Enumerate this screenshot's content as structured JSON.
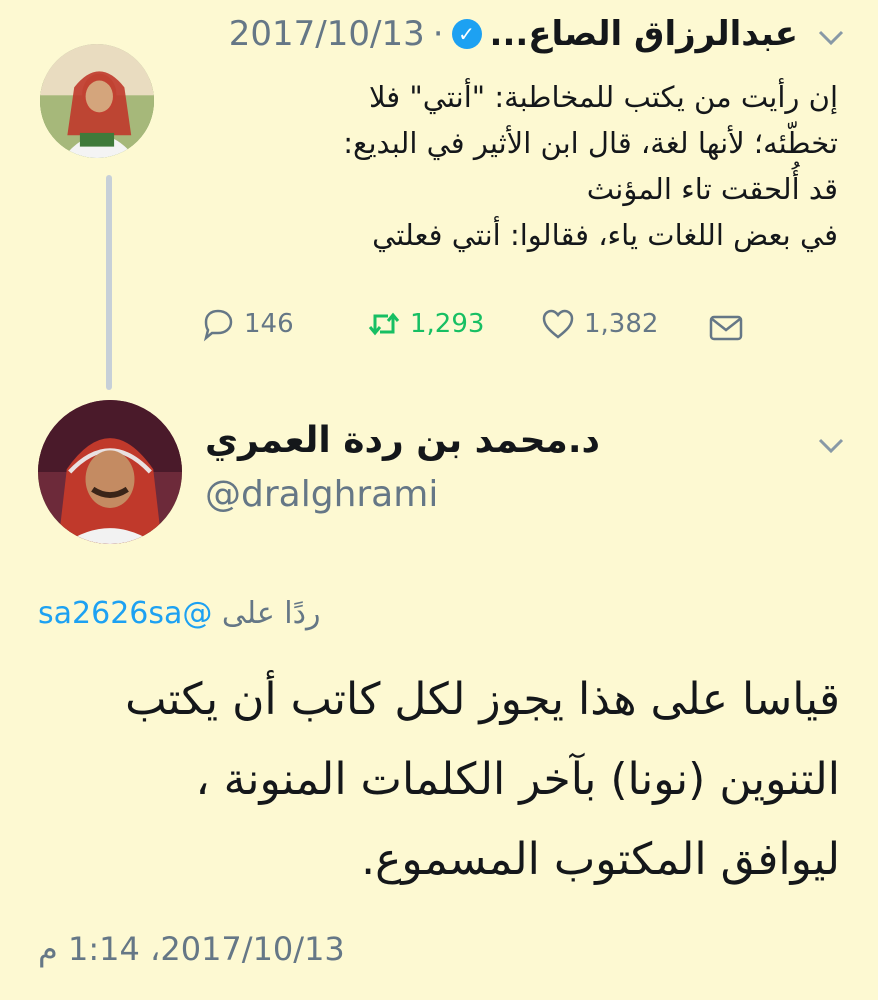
{
  "tweet1": {
    "author_name": "عبدالرزاق الصاع...",
    "separator": "·",
    "date": "2017/10/13",
    "text_lines": [
      "إن رأيت من يكتب للمخاطبة: \"أنتي\" فلا",
      "تخطّئه؛ لأنها لغة، قال ابن الأثير في البديع:",
      "قد أُلحقت تاء المؤنث",
      "في بعض اللغات ياء، فقالوا: أنتي فعلتي"
    ],
    "replies_count": "146",
    "retweets_count": "1,293",
    "likes_count": "1,382",
    "icons": {
      "reply": "reply-icon",
      "retweet": "retweet-icon",
      "like": "heart-icon",
      "message": "envelope-icon",
      "verified": "verified-badge-icon",
      "menu": "chevron-down-icon"
    }
  },
  "tweet2": {
    "author_name": "د.محمد بن ردة العمري",
    "handle": "@dralghrami",
    "reply_prefix": "ردًا على",
    "reply_mention": "@sa2626sa",
    "text_lines": [
      "قياسا على هذا يجوز لكل كاتب أن يكتب",
      "التنوين (نونا) بآخر الكلمات المنونة ،",
      "ليوافق المكتوب المسموع."
    ],
    "timestamp": "2017/10/13، 1:14 م"
  },
  "colors": {
    "background": "#fdf9d2",
    "retweet_green": "#17bf63",
    "link_blue": "#1da1f2",
    "muted_gray": "#657786"
  }
}
